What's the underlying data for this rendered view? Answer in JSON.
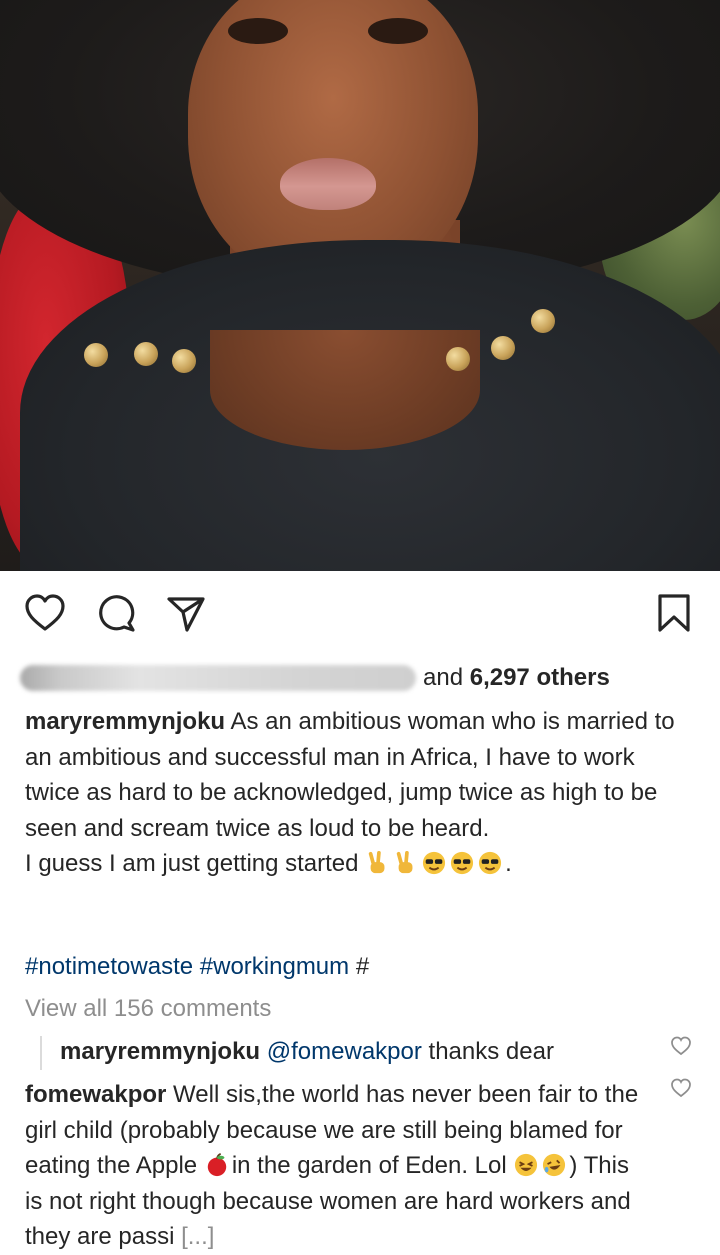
{
  "post": {
    "photo_alt": "",
    "likes": {
      "prefix": "and ",
      "count": "6,297 others"
    },
    "caption": {
      "username": "maryremmynjoku",
      "text": " As an ambitious woman who is married to an ambitious and successful man in Africa, I have to work twice as hard to be acknowledged, jump twice as high to be seen and scream twice as loud to be heard.",
      "line2": "I guess I am just getting started ",
      "line2_end": "."
    },
    "hashtags": {
      "tag1": "#notimetowaste",
      "tag2": "#workingmum",
      "tag3": "#"
    },
    "view_all": "View all 156 comments",
    "reply": {
      "username": "maryremmynjoku",
      "mention": "@fomewakpor",
      "text": " thanks dear"
    },
    "comment": {
      "username": "fomewakpor",
      "text1": " Well sis,the world has never been fair to the girl child (probably because we are still being blamed for eating the Apple ",
      "text2": "in the garden of Eden. Lol ",
      "text3": ") This is not right though because women are hard workers and they are passi ",
      "more": "[...]"
    }
  },
  "icons": [
    "heart-icon",
    "comment-icon",
    "share-icon",
    "bookmark-icon",
    "comment-like-icon"
  ],
  "colors": {
    "text": "#262626",
    "link": "#00376b",
    "muted": "#8e8e8e"
  }
}
